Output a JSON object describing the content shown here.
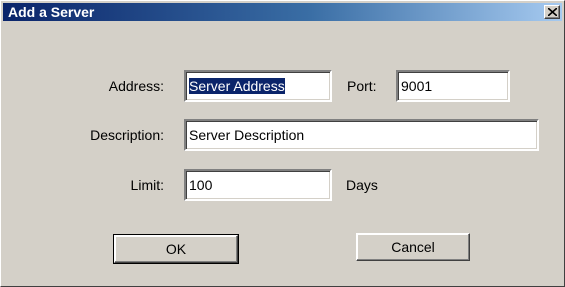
{
  "window": {
    "title": "Add a Server"
  },
  "form": {
    "address_label": "Address:",
    "address_value": "Server Address",
    "port_label": "Port:",
    "port_value": "9001",
    "description_label": "Description:",
    "description_value": "Server Description",
    "limit_label": "Limit:",
    "limit_value": "100",
    "limit_unit": "Days"
  },
  "buttons": {
    "ok_label": "OK",
    "cancel_label": "Cancel"
  },
  "icons": {
    "close": "close-icon"
  },
  "colors": {
    "titlebar_start": "#0a246a",
    "titlebar_end": "#a6caf0",
    "dialog_bg": "#d4d0c8",
    "selection": "#0a246a"
  }
}
